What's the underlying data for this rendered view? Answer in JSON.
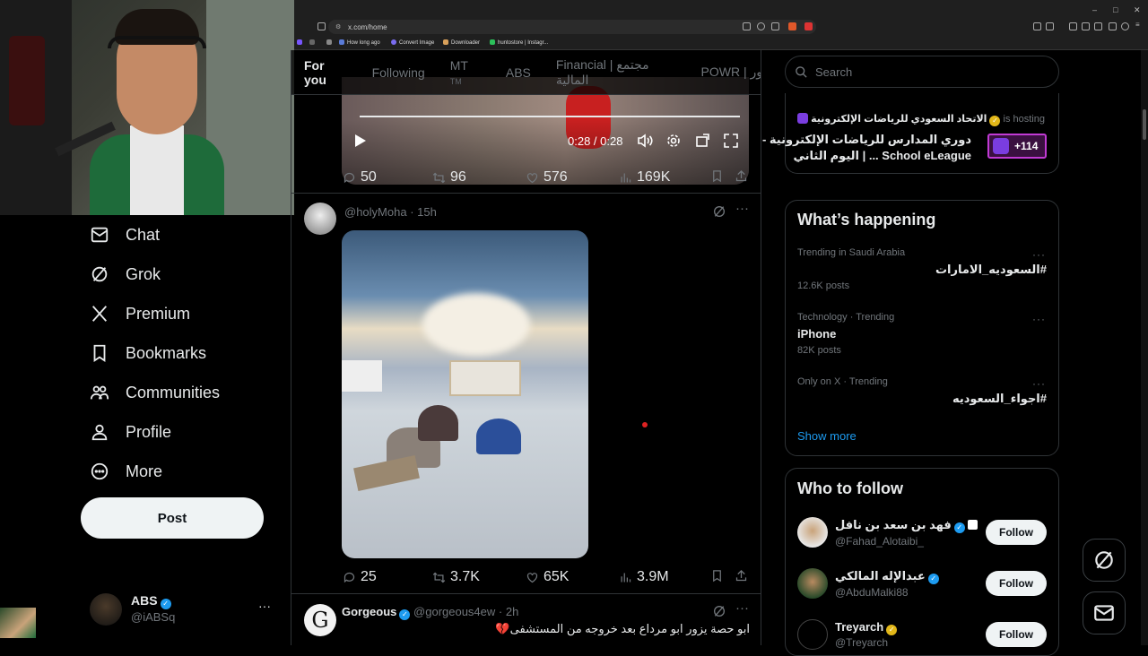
{
  "browser": {
    "url": "x.com/home",
    "bookmarks": [
      "How long ago",
      "Convert Image",
      "Downloader",
      "huntostore | Instagr..."
    ],
    "window_controls": [
      "–",
      "□",
      "✕"
    ]
  },
  "nav": {
    "items": [
      {
        "label": "Chat",
        "icon": "chat-icon"
      },
      {
        "label": "Grok",
        "icon": "grok-icon"
      },
      {
        "label": "Premium",
        "icon": "x-logo-icon"
      },
      {
        "label": "Bookmarks",
        "icon": "bookmark-icon"
      },
      {
        "label": "Communities",
        "icon": "communities-icon"
      },
      {
        "label": "Profile",
        "icon": "profile-icon"
      },
      {
        "label": "More",
        "icon": "more-circle-icon"
      }
    ],
    "post_label": "Post",
    "account": {
      "name": "ABS",
      "handle": "@iABSq",
      "more": "···"
    }
  },
  "timeline": {
    "tabs": [
      "For you",
      "Following",
      "MT",
      "ABS",
      "Financial | مجتمع المالية",
      "POWR | ور"
    ],
    "tab_badge": "TM",
    "video": {
      "time": "0:28 / 0:28",
      "progress": 1.0
    },
    "tweet1_stats": {
      "replies": "50",
      "reposts": "96",
      "likes": "576",
      "views": "169K"
    },
    "tweet2": {
      "handle": "@holyMoha",
      "time": "· 15h",
      "stats": {
        "replies": "25",
        "reposts": "3.7K",
        "likes": "65K",
        "views": "3.9M"
      }
    },
    "tweet3": {
      "name": "Gorgeous",
      "handle": "@gorgeous4ew",
      "time": "· 2h",
      "text": "ابو حصة يزور ابو مرداع بعد خروجه من المستشفى💔"
    }
  },
  "sidebar": {
    "search_placeholder": "Search",
    "space": {
      "host": "الاتحاد السعودي للرياضات الإلكترونية",
      "status": "is hosting",
      "title_line1": "دوري المدارس للرياضات الإلكترونية -",
      "title_line2": "School eLeague ... | اليوم الثاني",
      "count": "+114"
    },
    "happening": {
      "title": "What’s happening",
      "trends": [
        {
          "context": "Trending in Saudi Arabia",
          "name": "#السعوديه_الامارات",
          "posts": "12.6K posts"
        },
        {
          "context": "Technology · Trending",
          "name": "iPhone",
          "posts": "82K posts"
        },
        {
          "context": "Only on X · Trending",
          "name": "#اجواء_السعوديه",
          "posts": ""
        }
      ],
      "show_more": "Show more"
    },
    "who_to_follow": {
      "title": "Who to follow",
      "users": [
        {
          "name": "فهد بن سعد بن نافل",
          "handle": "@Fahad_Alotaibi_",
          "button": "Follow"
        },
        {
          "name": "عبدالإله المالكي",
          "handle": "@AbduMalki88",
          "button": "Follow"
        },
        {
          "name": "Treyarch",
          "handle": "@Treyarch",
          "button": "Follow"
        }
      ]
    }
  },
  "colors": {
    "accent": "#1d9bf0",
    "gold": "#e2b719",
    "bg": "#000000",
    "border": "#2f3336"
  }
}
